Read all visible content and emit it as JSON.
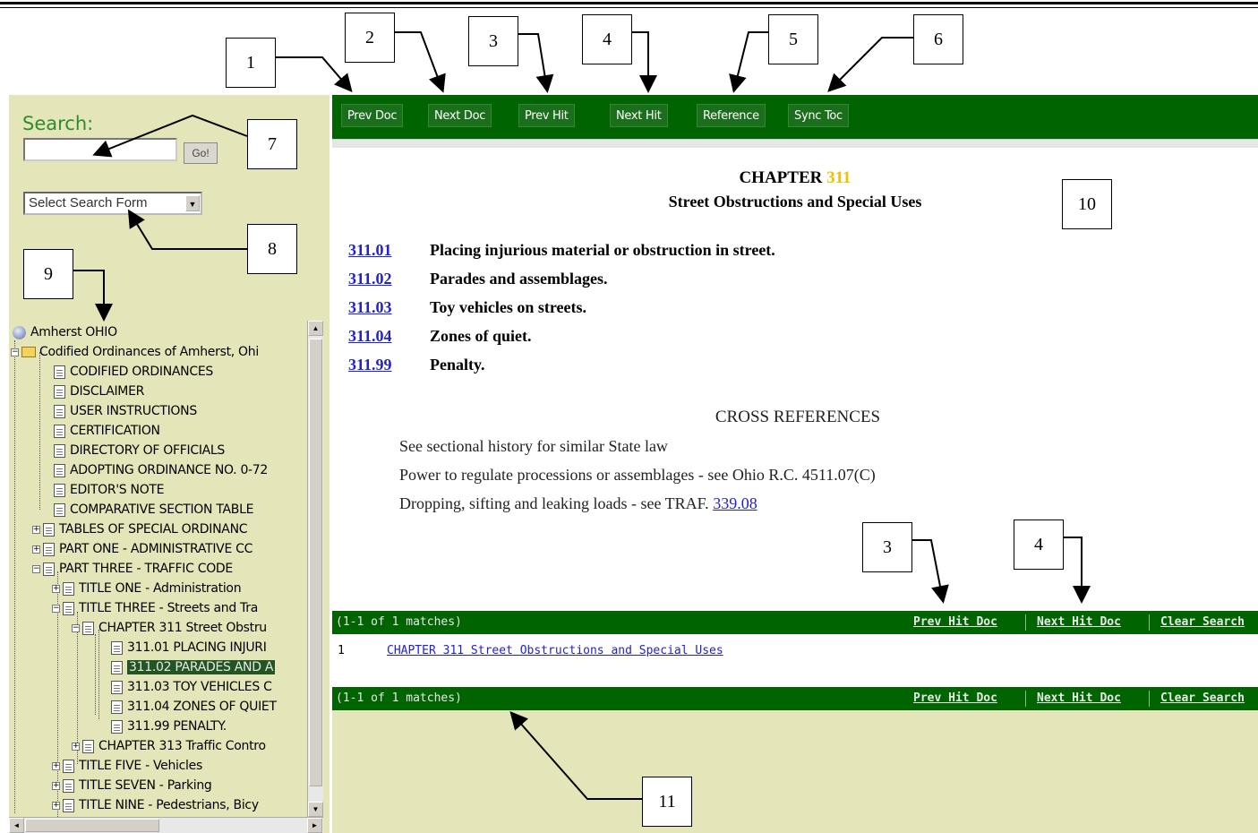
{
  "toolbar": {
    "prev_doc": "Prev Doc",
    "next_doc": "Next Doc",
    "prev_hit": "Prev Hit",
    "next_hit": "Next Hit",
    "reference": "Reference",
    "sync_toc": "Sync Toc"
  },
  "search": {
    "label": "Search:",
    "input_value": "",
    "go_label": "Go!",
    "form_select": "Select Search Form"
  },
  "tree": {
    "root": "Amherst OHIO",
    "items": [
      "Codified Ordinances of Amherst, Ohi",
      "CODIFIED ORDINANCES",
      "DISCLAIMER",
      "USER INSTRUCTIONS",
      "CERTIFICATION",
      "DIRECTORY OF OFFICIALS",
      "ADOPTING ORDINANCE NO. 0-72",
      "EDITOR'S NOTE",
      "COMPARATIVE SECTION TABLE",
      "TABLES OF SPECIAL ORDINANC",
      "PART ONE - ADMINISTRATIVE CC",
      "PART THREE - TRAFFIC CODE",
      "TITLE ONE - Administration",
      "TITLE THREE - Streets and Tra",
      "CHAPTER 311 Street Obstru",
      "311.01  PLACING INJURI",
      "311.02  PARADES AND A",
      "311.03  TOY VEHICLES C",
      "311.04 ZONES OF QUIET",
      "311.99  PENALTY.",
      "CHAPTER 313 Traffic Contro",
      "TITLE FIVE - Vehicles",
      "TITLE SEVEN - Parking",
      "TITLE NINE - Pedestrians, Bicy"
    ]
  },
  "document": {
    "chapter_prefix": "CHAPTER ",
    "chapter_number": "311",
    "chapter_subtitle": "Street Obstructions and Special Uses",
    "sections": [
      {
        "num": "311.01",
        "title": "Placing injurious material or obstruction in street."
      },
      {
        "num": "311.02",
        "title": "Parades and assemblages."
      },
      {
        "num": "311.03",
        "title": "Toy vehicles on streets."
      },
      {
        "num": "311.04",
        "title": "Zones of quiet."
      },
      {
        "num": "311.99",
        "title": "Penalty."
      }
    ],
    "cross_title": "CROSS REFERENCES",
    "cross_refs": [
      "See sectional history for similar State law",
      "Power to regulate processions or assemblages - see Ohio R.C. 4511.07(C)",
      "Dropping, sifting and leaking loads - see TRAF. "
    ],
    "cross_ref_link": "339.08"
  },
  "hits": {
    "count_text": "(1-1 of 1 matches)",
    "prev_hit_doc": "Prev Hit Doc",
    "next_hit_doc": "Next Hit Doc",
    "clear_search": "Clear Search",
    "result_num": "1",
    "result_link": "CHAPTER 311 Street Obstructions and Special Uses"
  },
  "callouts": {
    "c1": "1",
    "c2": "2",
    "c3": "3",
    "c4": "4",
    "c5": "5",
    "c6": "6",
    "c7": "7",
    "c8": "8",
    "c9": "9",
    "c10": "10",
    "c11": "11",
    "c3b": "3",
    "c4b": "4"
  },
  "colors": {
    "toolbar_green": "#006400",
    "pane_tan": "#e5e5ba",
    "link_blue": "#2222cc",
    "search_label_green": "#2e8b2e",
    "chapter_number_yellow": "#f0c000"
  }
}
